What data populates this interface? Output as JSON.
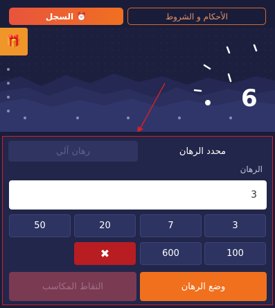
{
  "header": {
    "history_label": "السجل",
    "history_icon": "alarm-clock-icon",
    "terms_label": "الأحكام و الشروط"
  },
  "game": {
    "gift_icon": "gift-icon",
    "multiplier": "6"
  },
  "bet_panel": {
    "tabs": {
      "manual": "محدد الرهان",
      "auto": "رهان آلي"
    },
    "bet_label": "الرهان",
    "bet_value": "3",
    "chips": [
      "3",
      "7",
      "20",
      "50",
      "100",
      "600"
    ],
    "clear_icon": "close-icon",
    "place_bet_label": "وضع الرهان",
    "cashout_label": "التقاط المكاسب"
  },
  "colors": {
    "accent_orange": "#f07022",
    "panel_border": "#d0202a",
    "clear_red": "#b81d22"
  }
}
